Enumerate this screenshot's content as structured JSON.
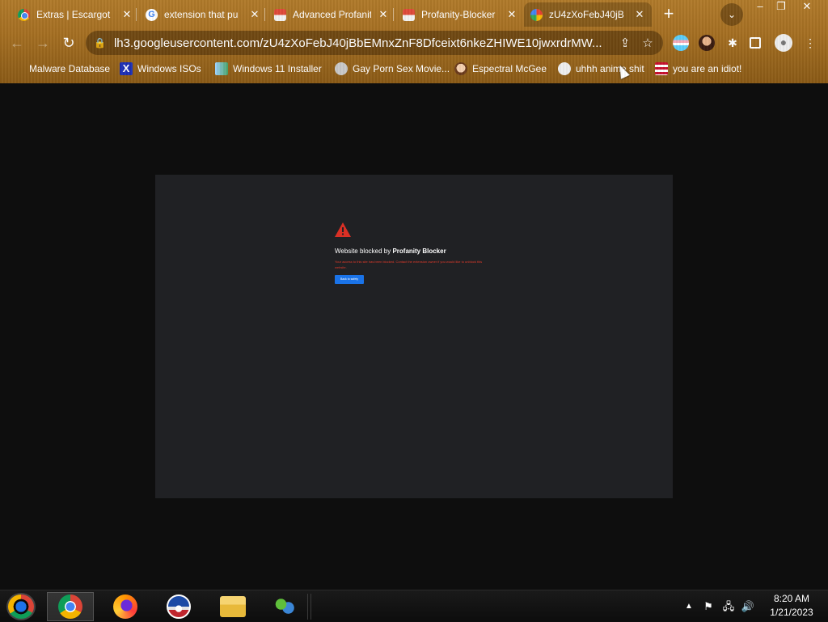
{
  "tabs": [
    {
      "title": "Extras | Escargot",
      "favicon": "chrome-icon",
      "active": false
    },
    {
      "title": "extension that pu",
      "favicon": "google-icon",
      "active": false
    },
    {
      "title": "Advanced Profanit",
      "favicon": "webstore-icon",
      "active": false
    },
    {
      "title": "Profanity-Blocker",
      "favicon": "webstore-icon",
      "active": false
    },
    {
      "title": "zU4zXoFebJ40jB",
      "favicon": "photos-icon",
      "active": true
    }
  ],
  "toolbar": {
    "url": "lh3.googleusercontent.com/zU4zXoFebJ40jBbEMnxZnF8Dfceixt6nkeZHIWE10jwxrdrMW..."
  },
  "bookmarks": [
    {
      "label": "Malware Database",
      "icon": "blank-icon"
    },
    {
      "label": "Windows ISOs",
      "icon": "x-icon"
    },
    {
      "label": "Windows 11 Installer",
      "icon": "windows-installer-icon"
    },
    {
      "label": "Gay Porn Sex Movie...",
      "icon": "site-icon"
    },
    {
      "label": "Espectral McGee",
      "icon": "face-icon"
    },
    {
      "label": "uhhh anime shit",
      "icon": "anime-icon"
    },
    {
      "label": "you are an idiot!",
      "icon": "flag-icon"
    }
  ],
  "page": {
    "block_prefix": "Website blocked by ",
    "block_brand": "Profanity Blocker",
    "block_message": "Your access to this site has been blocked. Contact the extension owner if you would like to unblock this website.",
    "safety_button": "Back to safety"
  },
  "taskbar": {
    "apps": [
      "chrome-icon",
      "firefox-icon",
      "obama-icon",
      "folder-icon",
      "msn-icon"
    ],
    "time": "8:20 AM",
    "date": "1/21/2023"
  },
  "colors": {
    "chrome_bg": "#a56f22",
    "page_frame": "#202124",
    "error_text": "#e03a2a",
    "button_blue": "#1a73e8"
  }
}
